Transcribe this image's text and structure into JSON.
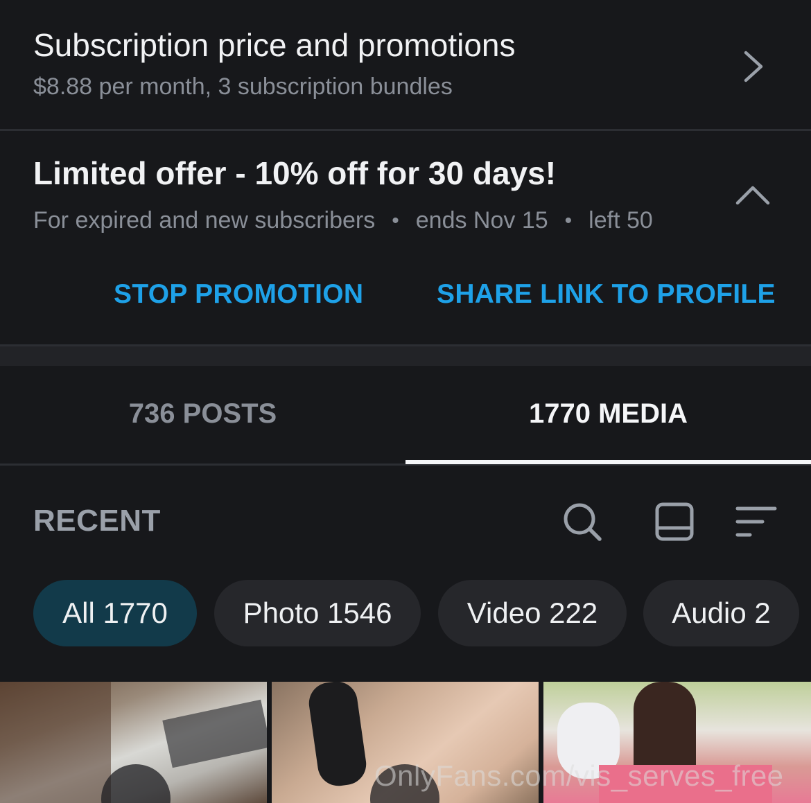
{
  "subscription": {
    "title": "Subscription price and promotions",
    "description": "$8.88 per month, 3 subscription bundles",
    "icon": "chevron-right-icon"
  },
  "promotion": {
    "title": "Limited offer - 10% off for 30 days!",
    "audience": "For expired and new subscribers",
    "ends": "ends Nov 15",
    "left": "left 50",
    "separator": "•",
    "icon": "chevron-up-icon",
    "stop_label": "STOP PROMOTION",
    "share_label": "SHARE LINK TO PROFILE"
  },
  "tabs": [
    {
      "label": "736 POSTS",
      "active": false
    },
    {
      "label": "1770 MEDIA",
      "active": true
    }
  ],
  "media": {
    "section_label": "RECENT",
    "tools": [
      "search-icon",
      "layout-toggle-icon",
      "sort-icon"
    ],
    "filters": [
      {
        "label": "All 1770",
        "active": true
      },
      {
        "label": "Photo 1546",
        "active": false
      },
      {
        "label": "Video 222",
        "active": false
      },
      {
        "label": "Audio 2",
        "active": false
      }
    ],
    "watermark": "OnlyFans.com/vis_serves_free"
  },
  "colors": {
    "background": "#17181b",
    "accent": "#1ea1e8",
    "active_chip": "#123a4a",
    "muted_text": "#8a8f98"
  }
}
